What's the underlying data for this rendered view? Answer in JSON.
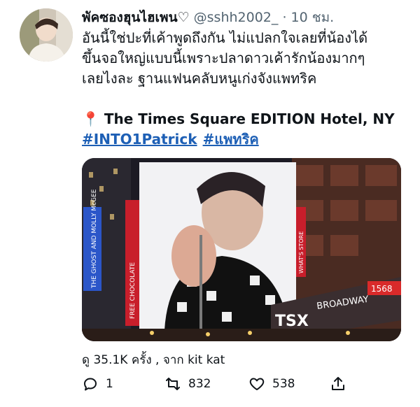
{
  "tweet": {
    "author_name": "พัคซองฮุนไฮเพน♡",
    "handle": "@sshh2002_",
    "separator": "·",
    "time": "10 ชม.",
    "text_lines": [
      "อันนี้ใช่ปะที่เค้าพูดถึงกัน ไม่แปลกใจเลยที่น้องได้",
      "ขึ้นจอใหญ่แบบนี้เพราะปลาดาวเค้ารักน้องมากๆ",
      "เลยไงละ ฐานแฟนคลับหนูเก่งจังแพทริค"
    ],
    "location_pin": "📍",
    "location": "The Times Square EDITION Hotel, NY",
    "hashtags": [
      "#INTO1Patrick",
      "#แพทริค"
    ],
    "media_signs": {
      "left_sign": "THE GHOST AND MOLLY McGEE",
      "strip_sign": "FREE CHOCOLATE",
      "billboard_strip": "WHAT'S STORE",
      "tsx": "TSX",
      "broadway": "BROADWAY",
      "address": "1568"
    },
    "views_line": "ดู 35.1K ครั้ง , จาก kit kat",
    "replies": "1",
    "retweets": "832",
    "likes": "538",
    "colors": {
      "link": "#1d5fb5",
      "muted": "#536471"
    }
  }
}
